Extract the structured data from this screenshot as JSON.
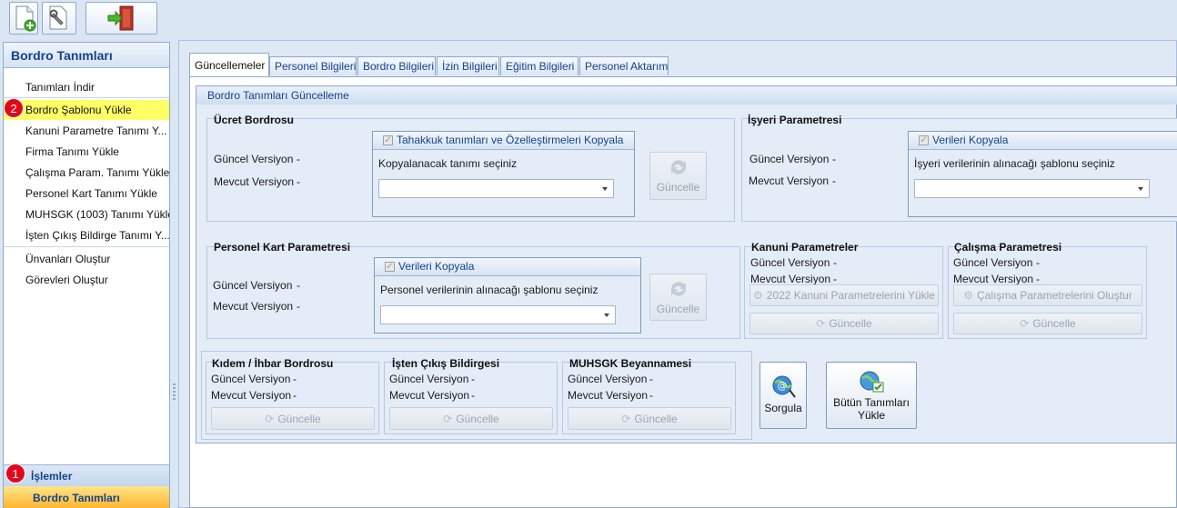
{
  "toolbar": {
    "icons": [
      "new-document-icon",
      "settings-document-icon",
      "exit-door-icon"
    ]
  },
  "sidebar": {
    "title": "Bordro Tanımları",
    "items": [
      {
        "label": "Tanımları İndir"
      },
      {
        "label": "Bordro Şablonu Yükle",
        "selected": true
      },
      {
        "label": "Kanuni Parametre Tanımı Y..."
      },
      {
        "label": "Firma Tanımı Yükle"
      },
      {
        "label": "Çalışma Param. Tanımı Yükle"
      },
      {
        "label": "Personel Kart Tanımı Yükle"
      },
      {
        "label": "MUHSGK (1003) Tanımı Yükle"
      },
      {
        "label": "İşten Çıkış Bildirge Tanımı Y..."
      },
      {
        "label": "Ünvanları Oluştur"
      },
      {
        "label": "Görevleri Oluştur"
      }
    ],
    "group_label": "İşlemler",
    "active_label": "Bordro Tanımları",
    "badges": {
      "one": "1",
      "two": "2"
    }
  },
  "tabs": [
    "Güncellemeler",
    "Personel Bilgileri",
    "Bordro Bilgileri",
    "İzin Bilgileri",
    "Eğitim Bilgileri",
    "Personel Aktarım"
  ],
  "main": {
    "group_title": "Bordro Tanımları Güncelleme",
    "current_version": "Güncel Versiyon",
    "existing_version": "Mevcut Versiyon",
    "dash": "-",
    "update_label": "Güncelle",
    "ucret": {
      "title": "Ücret Bordrosu",
      "copy_label": "Tahakkuk tanımları ve Özelleştirmeleri Kopyala",
      "select_hint": "Kopyalanacak tanımı seçiniz"
    },
    "isyeri": {
      "title": "İşyeri Parametresi",
      "copy_label": "Verileri Kopyala",
      "select_hint": "İşyeri verilerinin alınacağı şablonu seçiniz"
    },
    "personel": {
      "title": "Personel Kart Parametresi",
      "copy_label": "Verileri Kopyala",
      "select_hint": "Personel verilerinin alınacağı şablonu seçiniz"
    },
    "kanuni": {
      "title": "Kanuni Parametreler",
      "action": "2022 Kanuni Parametrelerini Yükle"
    },
    "calisma": {
      "title": "Çalışma Parametresi",
      "action": "Çalışma Parametrelerini Oluştur"
    },
    "kidem": {
      "title": "Kıdem / İhbar Bordrosu"
    },
    "isten": {
      "title": "İşten Çıkış Bildirgesi"
    },
    "muhsgk": {
      "title": "MUHSGK Beyannamesi"
    },
    "query_label": "Sorgula",
    "load_all_line1": "Bütün Tanımları",
    "load_all_line2": "Yükle"
  }
}
